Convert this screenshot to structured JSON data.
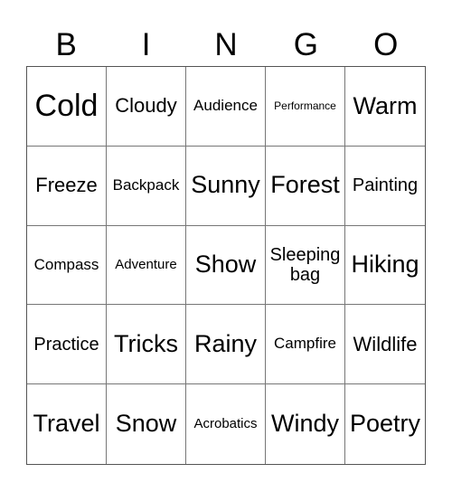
{
  "header": {
    "letters": [
      "B",
      "I",
      "N",
      "G",
      "O"
    ]
  },
  "cells": [
    {
      "text": "Cold",
      "size": "s-xl"
    },
    {
      "text": "Cloudy",
      "size": "s-m"
    },
    {
      "text": "Audience",
      "size": "s-s"
    },
    {
      "text": "Performance",
      "size": "s-xxs"
    },
    {
      "text": "Warm",
      "size": "s-l"
    },
    {
      "text": "Freeze",
      "size": "s-m"
    },
    {
      "text": "Backpack",
      "size": "s-s"
    },
    {
      "text": "Sunny",
      "size": "s-l"
    },
    {
      "text": "Forest",
      "size": "s-l"
    },
    {
      "text": "Painting",
      "size": "s-ms"
    },
    {
      "text": "Compass",
      "size": "s-s"
    },
    {
      "text": "Adventure",
      "size": "s-xs"
    },
    {
      "text": "Show",
      "size": "s-l"
    },
    {
      "text": "Sleeping bag",
      "size": "s-ms"
    },
    {
      "text": "Hiking",
      "size": "s-l"
    },
    {
      "text": "Practice",
      "size": "s-ms"
    },
    {
      "text": "Tricks",
      "size": "s-l"
    },
    {
      "text": "Rainy",
      "size": "s-l"
    },
    {
      "text": "Campfire",
      "size": "s-s"
    },
    {
      "text": "Wildlife",
      "size": "s-m"
    },
    {
      "text": "Travel",
      "size": "s-l"
    },
    {
      "text": "Snow",
      "size": "s-l"
    },
    {
      "text": "Acrobatics",
      "size": "s-xs"
    },
    {
      "text": "Windy",
      "size": "s-l"
    },
    {
      "text": "Poetry",
      "size": "s-l"
    }
  ]
}
